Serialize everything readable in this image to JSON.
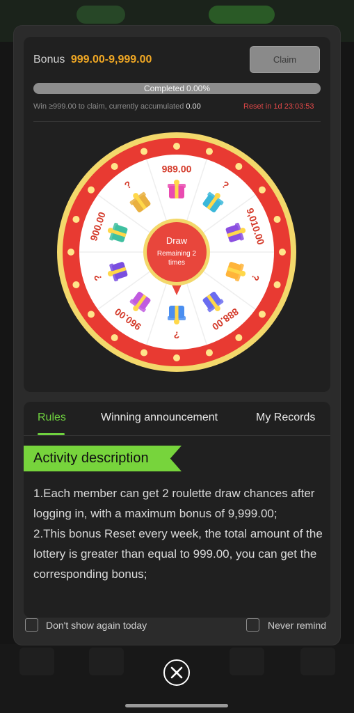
{
  "bonus": {
    "label": "Bonus",
    "amount": "999.00-9,999.00"
  },
  "claim_label": "Claim",
  "progress": {
    "label": "Completed",
    "value_text": "0.00%",
    "fraction": 0.0
  },
  "condition": {
    "text": "Win ≥999.00 to claim, currently accumulated",
    "value": "0.00"
  },
  "reset_text": "Reset in 1d 23:03:53",
  "wheel": {
    "segments": [
      "989.00",
      "?",
      "9,010.00",
      "?",
      "888.00",
      "?",
      "960.00",
      "?",
      "900.00",
      "?"
    ],
    "center_title": "Draw",
    "center_sub": "Remaining 2",
    "center_sub2": "times",
    "colors": {
      "rim": "#e83a32",
      "face": "#ffffff",
      "text": "#d43a2a",
      "gold": "#f3d86b",
      "hub": "#e8463c"
    }
  },
  "tabs": [
    {
      "label": "Rules",
      "active": true
    },
    {
      "label": "Winning announcement",
      "active": false
    },
    {
      "label": "My Records",
      "active": false
    }
  ],
  "section_title": "Activity description",
  "description": [
    "1.Each member can get 2 roulette draw chances after logging in, with a maximum bonus of 9,999.00;",
    "2.This bonus Reset every week, the total amount of the lottery is greater than equal to 999.00, you can get the corresponding bonus;"
  ],
  "checkbox_today": "Don't show again today",
  "checkbox_never": "Never remind",
  "accent": "#6fd23f"
}
